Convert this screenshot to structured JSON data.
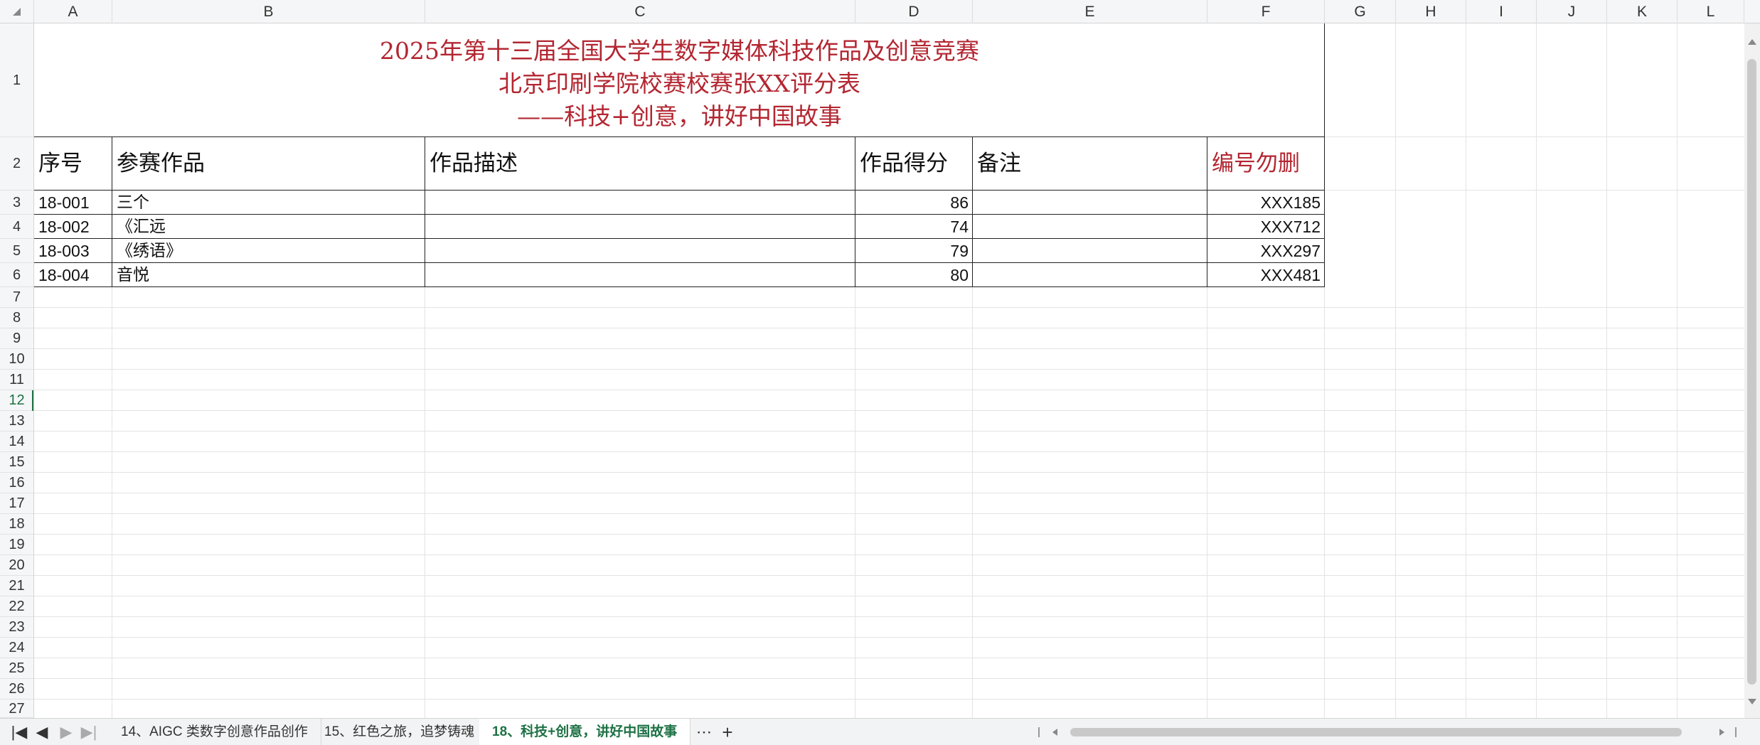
{
  "columns": [
    "A",
    "B",
    "C",
    "D",
    "E",
    "F",
    "G",
    "H",
    "I",
    "J",
    "K",
    "L"
  ],
  "rows": [
    "1",
    "2",
    "3",
    "4",
    "5",
    "6",
    "7",
    "8",
    "9",
    "10",
    "11",
    "12",
    "13",
    "14",
    "15",
    "16",
    "17",
    "18",
    "19",
    "20",
    "21",
    "22",
    "23",
    "24",
    "25",
    "26",
    "27"
  ],
  "active_row": "12",
  "title": {
    "line1": "2025年第十三届全国大学生数字媒体科技作品及创意竞赛",
    "line2": "北京印刷学院校赛校赛张XX评分表",
    "line3": "——科技+创意，讲好中国故事"
  },
  "headers": {
    "seq": "序号",
    "work": "参赛作品",
    "desc": "作品描述",
    "score": "作品得分",
    "note": "备注",
    "code": "编号勿删"
  },
  "entries": [
    {
      "seq": "18-001",
      "work": "三个",
      "desc": "",
      "score": "86",
      "note": "",
      "code": "XXX185"
    },
    {
      "seq": "18-002",
      "work": "《汇远",
      "desc": "",
      "score": "74",
      "note": "",
      "code": "XXX712"
    },
    {
      "seq": "18-003",
      "work": "《绣语》",
      "desc": "",
      "score": "79",
      "note": "",
      "code": "XXX297"
    },
    {
      "seq": "18-004",
      "work": "音悦",
      "desc": "",
      "score": "80",
      "note": "",
      "code": "XXX481"
    }
  ],
  "tabs": [
    {
      "label": "14、AIGC 类数字创意作品创作"
    },
    {
      "label": "15、红色之旅，追梦铸魂"
    },
    {
      "label": "18、科技+创意，讲好中国故事"
    }
  ],
  "tab_nav": {
    "first": "|◀",
    "prev": "◀",
    "next": "▶",
    "last": "▶|",
    "more": "⋯",
    "add": "+"
  },
  "colors": {
    "title_red": "#b32631",
    "accent_green": "#1e7145"
  }
}
